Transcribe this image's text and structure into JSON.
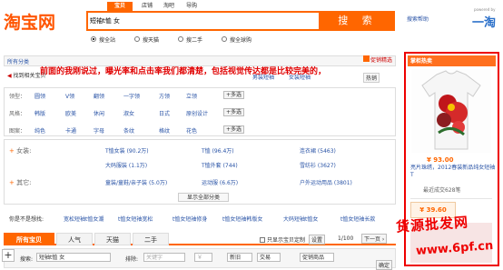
{
  "header": {
    "logo": "淘宝网",
    "tabs": [
      "宝贝",
      "店铺",
      "淘吧",
      "导购"
    ],
    "search_value": "短袖t恤 女",
    "search_button": "搜 索",
    "search_help": "搜索帮助",
    "powered_by": "powered by",
    "brand_right": "一淘",
    "scopes": [
      "搜全站",
      "搜天猫",
      "搜二手",
      "搜全球购"
    ]
  },
  "overlay_caption": "前面的我刚说过，曝光率和点击率我们都清楚，包括视觉传达都是比较完美的，",
  "categories": {
    "all_label": "所有分类",
    "title": "男装短袖恤精选",
    "promo_tag": "促销精选",
    "found_label": "找到相关宝贝",
    "right_links": [
      "男装短袖",
      "女装短袖"
    ],
    "hot_label": "热销"
  },
  "filters": {
    "rows": [
      {
        "label": "领型：",
        "tags": [
          "圆领",
          "V领",
          "翻领",
          "一字领",
          "方领",
          "立领"
        ],
        "more": "+多选"
      },
      {
        "label": "风格：",
        "tags": [
          "韩版",
          "欧美",
          "休闲",
          "淑女",
          "日式",
          "原创设计"
        ],
        "more": "+多选"
      },
      {
        "label": "图案：",
        "tags": [
          "纯色",
          "卡通",
          "字母",
          "条纹",
          "格纹",
          "花色"
        ],
        "more": "+多选"
      }
    ],
    "women_label": "女装:",
    "women_cats": [
      [
        "T恤女装 (90.2万)",
        "T恤 (96.4万)",
        "连衣裙 (5463)"
      ],
      [
        "大码服装 (1.1万)",
        "T恤外套 (744)",
        "雪纺衫 (3627)"
      ]
    ],
    "other_label": "其它:",
    "other_cats": [
      "童装/童鞋/亲子装 (5.0万)",
      "运动服 (6.6万)",
      "户外运动用品 (3801)"
    ],
    "show_all": "显示全部分类"
  },
  "suggest": {
    "label": "你是不是想找:",
    "items": [
      "宽松短袖t恤女潮",
      "t恤女短袖宽松",
      "t恤女短袖修身",
      "t恤女短袖韩版女",
      "大码短袖t恤女",
      "t恤女短袖长款"
    ]
  },
  "result_tabs": [
    "所有宝贝",
    "人气",
    "天猫",
    "二手"
  ],
  "sort_bar": {
    "only_label": "只显示宝贝定制",
    "settings": "设置",
    "page": "1/100",
    "next": "下一页"
  },
  "bottom_bar": {
    "search_label": "搜索:",
    "search_value": "短袖t恤 女",
    "exclude_label": "排除:",
    "exclude_placeholder": "关键字",
    "price_placeholder": "￥",
    "new_label": "新旧",
    "location_label": "交易",
    "promo_label": "促销商品",
    "confirm": "确定"
  },
  "promo": {
    "title": "掌柜热卖",
    "price": "¥ 93.00",
    "desc": "亮片珠绣，2012春装新品纯女短袖T",
    "sold": "最近成交628笔",
    "price2": "¥ 39.60"
  },
  "watermark": {
    "line1": "货源批发网",
    "line2": "www.6pf.cn"
  }
}
